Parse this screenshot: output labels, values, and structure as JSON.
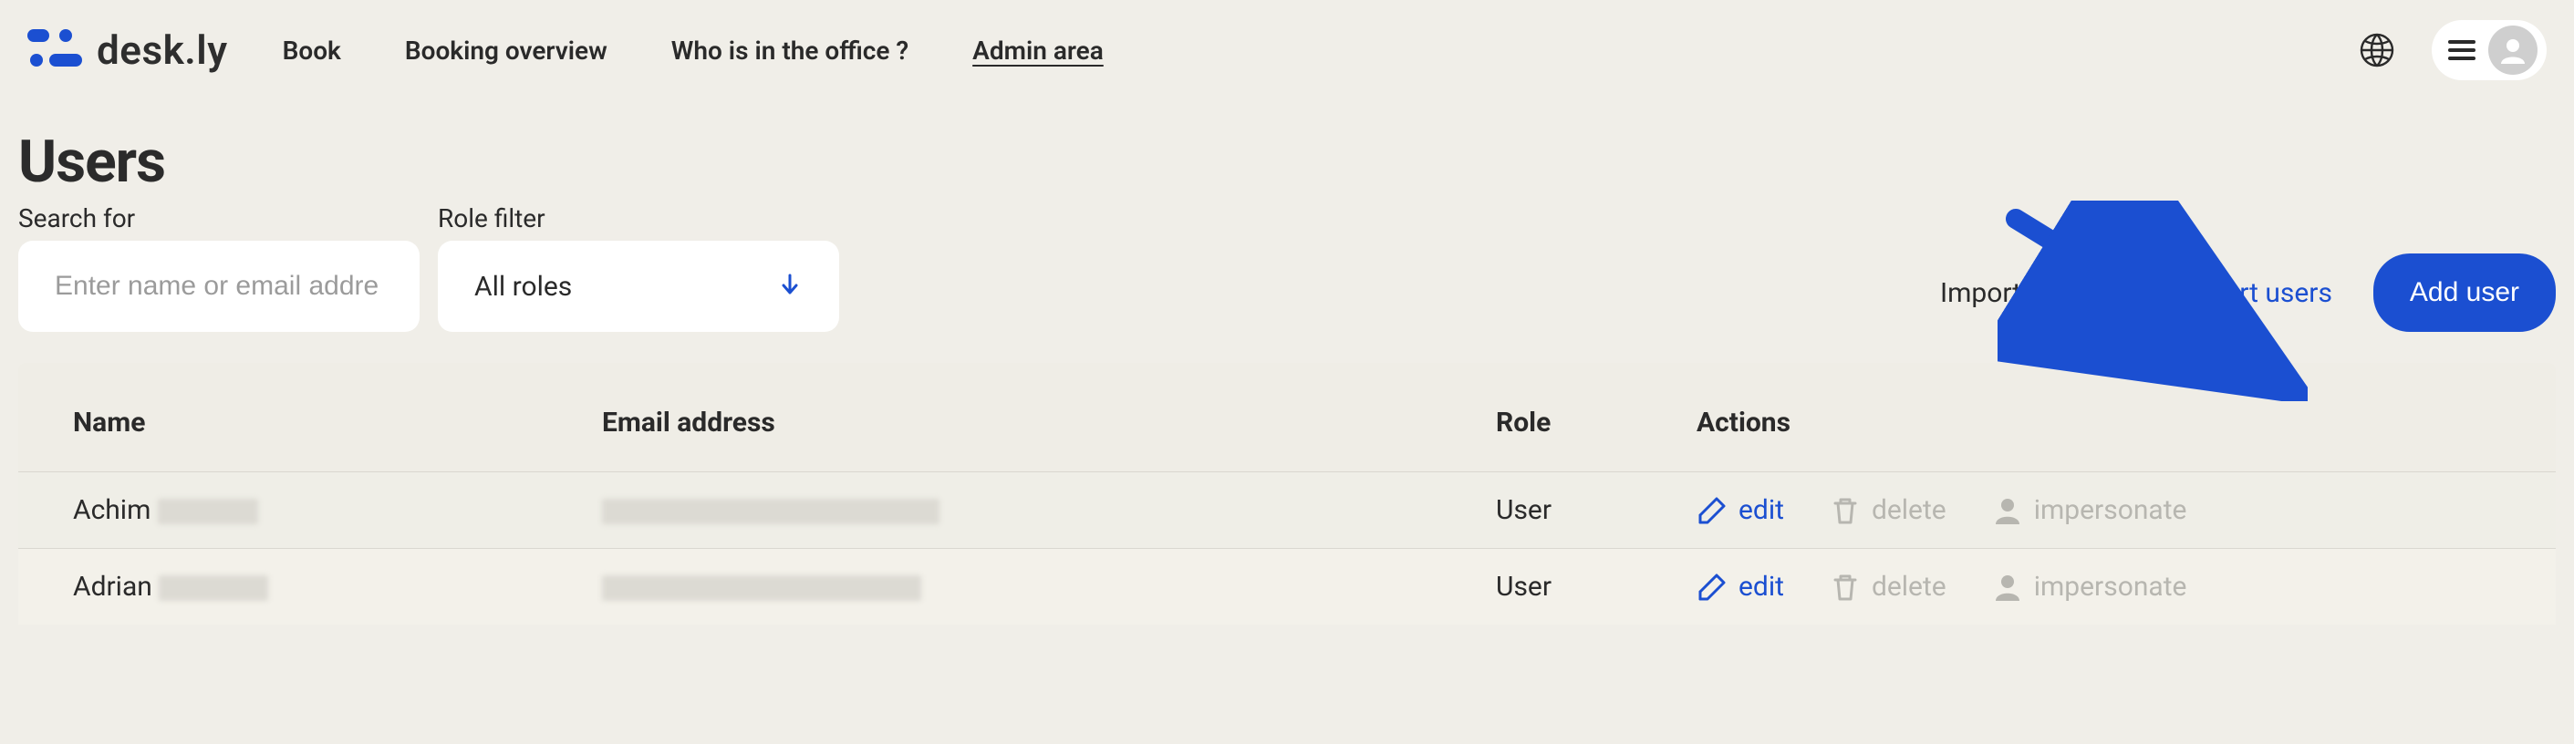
{
  "header": {
    "logo_text": "desk.ly",
    "nav": {
      "book": "Book",
      "overview": "Booking overview",
      "who": "Who is in the office ?",
      "admin": "Admin area"
    }
  },
  "page": {
    "title": "Users"
  },
  "filters": {
    "search_label": "Search for",
    "search_placeholder": "Enter name or email addre",
    "role_label": "Role filter",
    "role_value": "All roles"
  },
  "actionsBar": {
    "import_template": "Import template",
    "import_users": "Import users",
    "add_user": "Add user"
  },
  "table": {
    "headers": {
      "name": "Name",
      "email": "Email address",
      "role": "Role",
      "actions": "Actions"
    },
    "action_labels": {
      "edit": "edit",
      "delete": "delete",
      "impersonate": "impersonate"
    },
    "rows": [
      {
        "first_name": "Achim",
        "role": "User"
      },
      {
        "first_name": "Adrian",
        "role": "User"
      }
    ]
  },
  "colors": {
    "accent": "#1b4fd1",
    "bg": "#f0eee8"
  }
}
